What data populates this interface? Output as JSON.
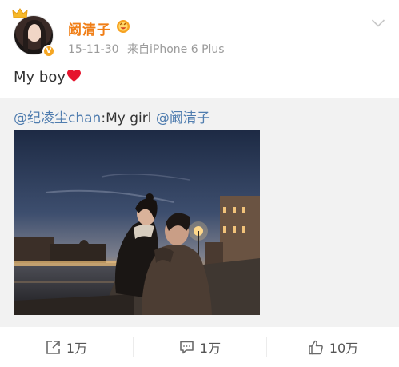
{
  "post": {
    "author": "阚清子",
    "timestamp": "15-11-30",
    "source": "来自iPhone 6 Plus",
    "text": "My boy",
    "heart": "❤"
  },
  "repost": {
    "mention_1": "@纪凌尘chan",
    "separator": ":",
    "text": "My girl ",
    "mention_2": "@阚清子"
  },
  "actions": {
    "share_count": "1万",
    "comment_count": "1万",
    "like_count": "10万"
  },
  "icons": {
    "crown": "crown-icon",
    "verified": "verified-icon",
    "vip": "vip-icon",
    "dropdown": "chevron-down-icon",
    "heart": "heart-icon",
    "share": "share-icon",
    "comment": "comment-icon",
    "like": "thumbs-up-icon"
  },
  "colors": {
    "author": "#f07e16",
    "mention": "#507daf",
    "heart": "#e6142d",
    "repost_bg": "#f2f2f2",
    "meta": "#9b9b9b"
  }
}
